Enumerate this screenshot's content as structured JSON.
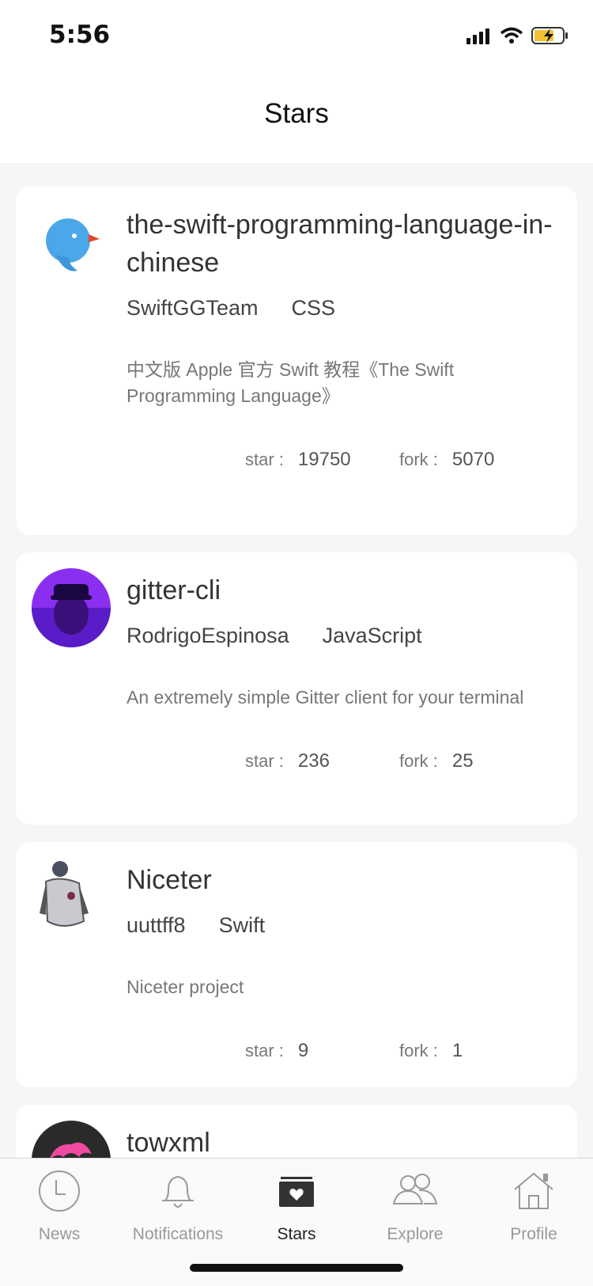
{
  "status_bar": {
    "time": "5:56"
  },
  "nav": {
    "title": "Stars"
  },
  "repos": [
    {
      "name": "the-swift-programming-language-in-chinese",
      "owner": "SwiftGGTeam",
      "language": "CSS",
      "description": "中文版 Apple 官方 Swift 教程《The Swift Programming Language》",
      "star_label": "star :",
      "stars": "19750",
      "fork_label": "fork :",
      "forks": "5070",
      "avatar_icon": "bird-icon"
    },
    {
      "name": "gitter-cli",
      "owner": "RodrigoEspinosa",
      "language": "JavaScript",
      "description": "An extremely simple Gitter client for your terminal",
      "star_label": "star :",
      "stars": "236",
      "fork_label": "fork :",
      "forks": "25",
      "avatar_icon": "person-avatar"
    },
    {
      "name": "Niceter",
      "owner": "uuttff8",
      "language": "Swift",
      "description": "Niceter project",
      "star_label": "star :",
      "stars": "9",
      "fork_label": "fork :",
      "forks": "1",
      "avatar_icon": "person-avatar"
    },
    {
      "name": "towxml",
      "avatar_icon": "logo-avatar"
    }
  ],
  "tabs": [
    {
      "label": "News",
      "icon": "clock-icon"
    },
    {
      "label": "Notifications",
      "icon": "bell-icon"
    },
    {
      "label": "Stars",
      "icon": "star-box-icon",
      "active": true
    },
    {
      "label": "Explore",
      "icon": "people-icon"
    },
    {
      "label": "Profile",
      "icon": "home-icon"
    }
  ],
  "colors": {
    "accent": "#222222",
    "inactive": "#999999",
    "card_bg": "#ffffff",
    "page_bg": "#f6f6f6"
  }
}
